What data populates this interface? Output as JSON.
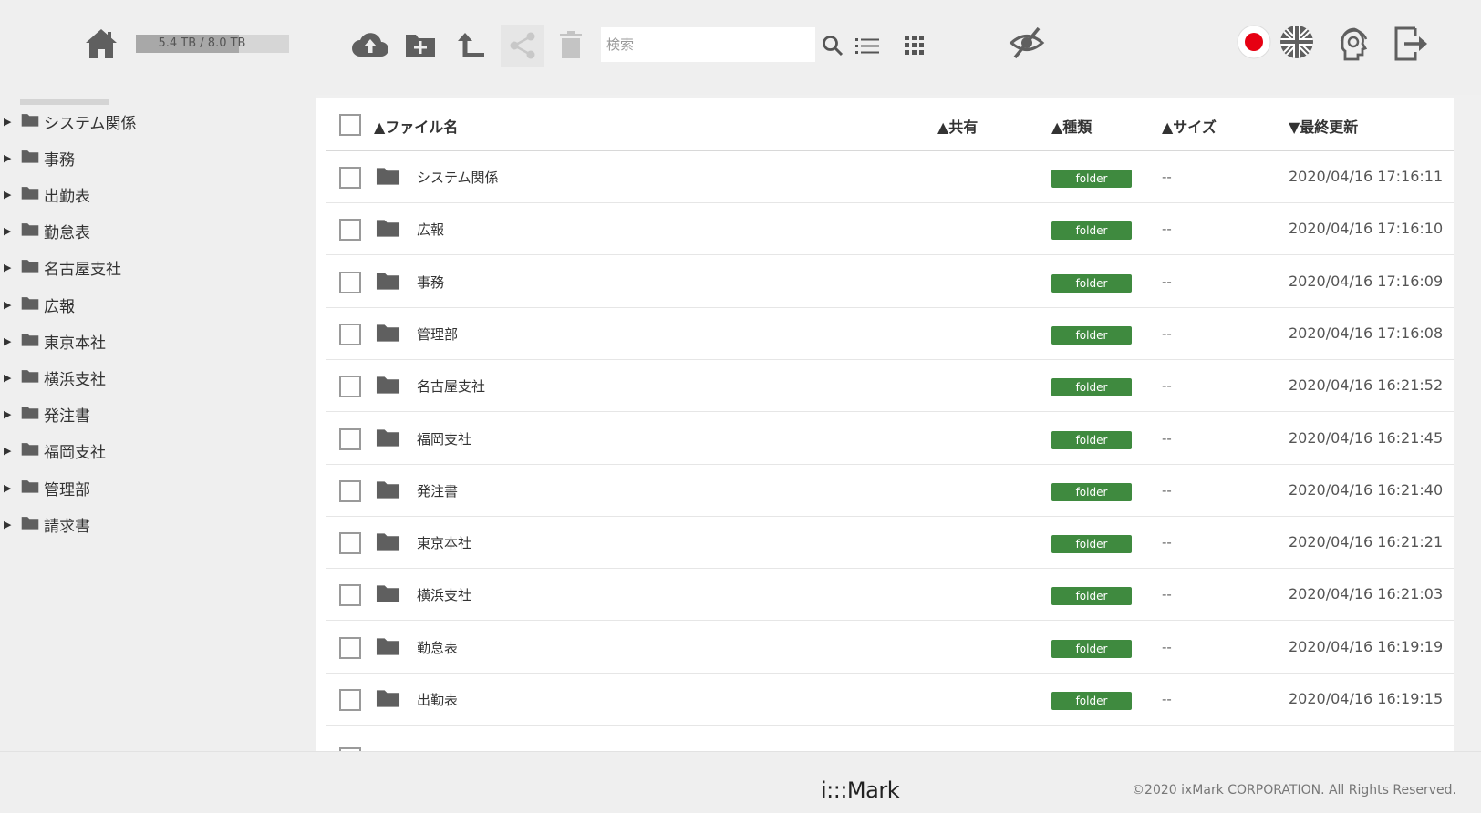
{
  "header": {
    "storage_text": "5.4 TB / 8.0 TB",
    "storage_used_fraction": 0.675,
    "search_placeholder": "検索",
    "icons": [
      "home-icon",
      "upload-cloud-icon",
      "new-folder-icon",
      "go-up-icon",
      "share-icon",
      "trash-icon",
      "search-icon",
      "list-view-icon",
      "grid-view-icon",
      "hide-icon",
      "japanese-flag-icon",
      "uk-flag-icon",
      "support-icon",
      "logout-icon"
    ]
  },
  "sidebar": {
    "items": [
      "システム関係",
      "事務",
      "出勤表",
      "勤怠表",
      "名古屋支社",
      "広報",
      "東京本社",
      "横浜支社",
      "発注書",
      "福岡支社",
      "管理部",
      "請求書"
    ]
  },
  "table": {
    "headers": {
      "name": "▲ファイル名",
      "shared": "▲共有",
      "type": "▲種類",
      "size": "▲サイズ",
      "modified": "▼最終更新"
    },
    "rows": [
      {
        "name": "システム関係",
        "type": "folder",
        "size": "--",
        "modified": "2020/04/16 17:16:11"
      },
      {
        "name": "広報",
        "type": "folder",
        "size": "--",
        "modified": "2020/04/16 17:16:10"
      },
      {
        "name": "事務",
        "type": "folder",
        "size": "--",
        "modified": "2020/04/16 17:16:09"
      },
      {
        "name": "管理部",
        "type": "folder",
        "size": "--",
        "modified": "2020/04/16 17:16:08"
      },
      {
        "name": "名古屋支社",
        "type": "folder",
        "size": "--",
        "modified": "2020/04/16 16:21:52"
      },
      {
        "name": "福岡支社",
        "type": "folder",
        "size": "--",
        "modified": "2020/04/16 16:21:45"
      },
      {
        "name": "発注書",
        "type": "folder",
        "size": "--",
        "modified": "2020/04/16 16:21:40"
      },
      {
        "name": "東京本社",
        "type": "folder",
        "size": "--",
        "modified": "2020/04/16 16:21:21"
      },
      {
        "name": "横浜支社",
        "type": "folder",
        "size": "--",
        "modified": "2020/04/16 16:21:03"
      },
      {
        "name": "勤怠表",
        "type": "folder",
        "size": "--",
        "modified": "2020/04/16 16:19:19"
      },
      {
        "name": "出勤表",
        "type": "folder",
        "size": "--",
        "modified": "2020/04/16 16:19:15"
      }
    ]
  },
  "footer": {
    "logo": "i:::Mark",
    "copyright": "©2020 ixMark CORPORATION. All Rights Reserved."
  },
  "colors": {
    "icon": "#5f5f5f",
    "badge": "#3f8a3f",
    "flag_red": "#e60012"
  }
}
